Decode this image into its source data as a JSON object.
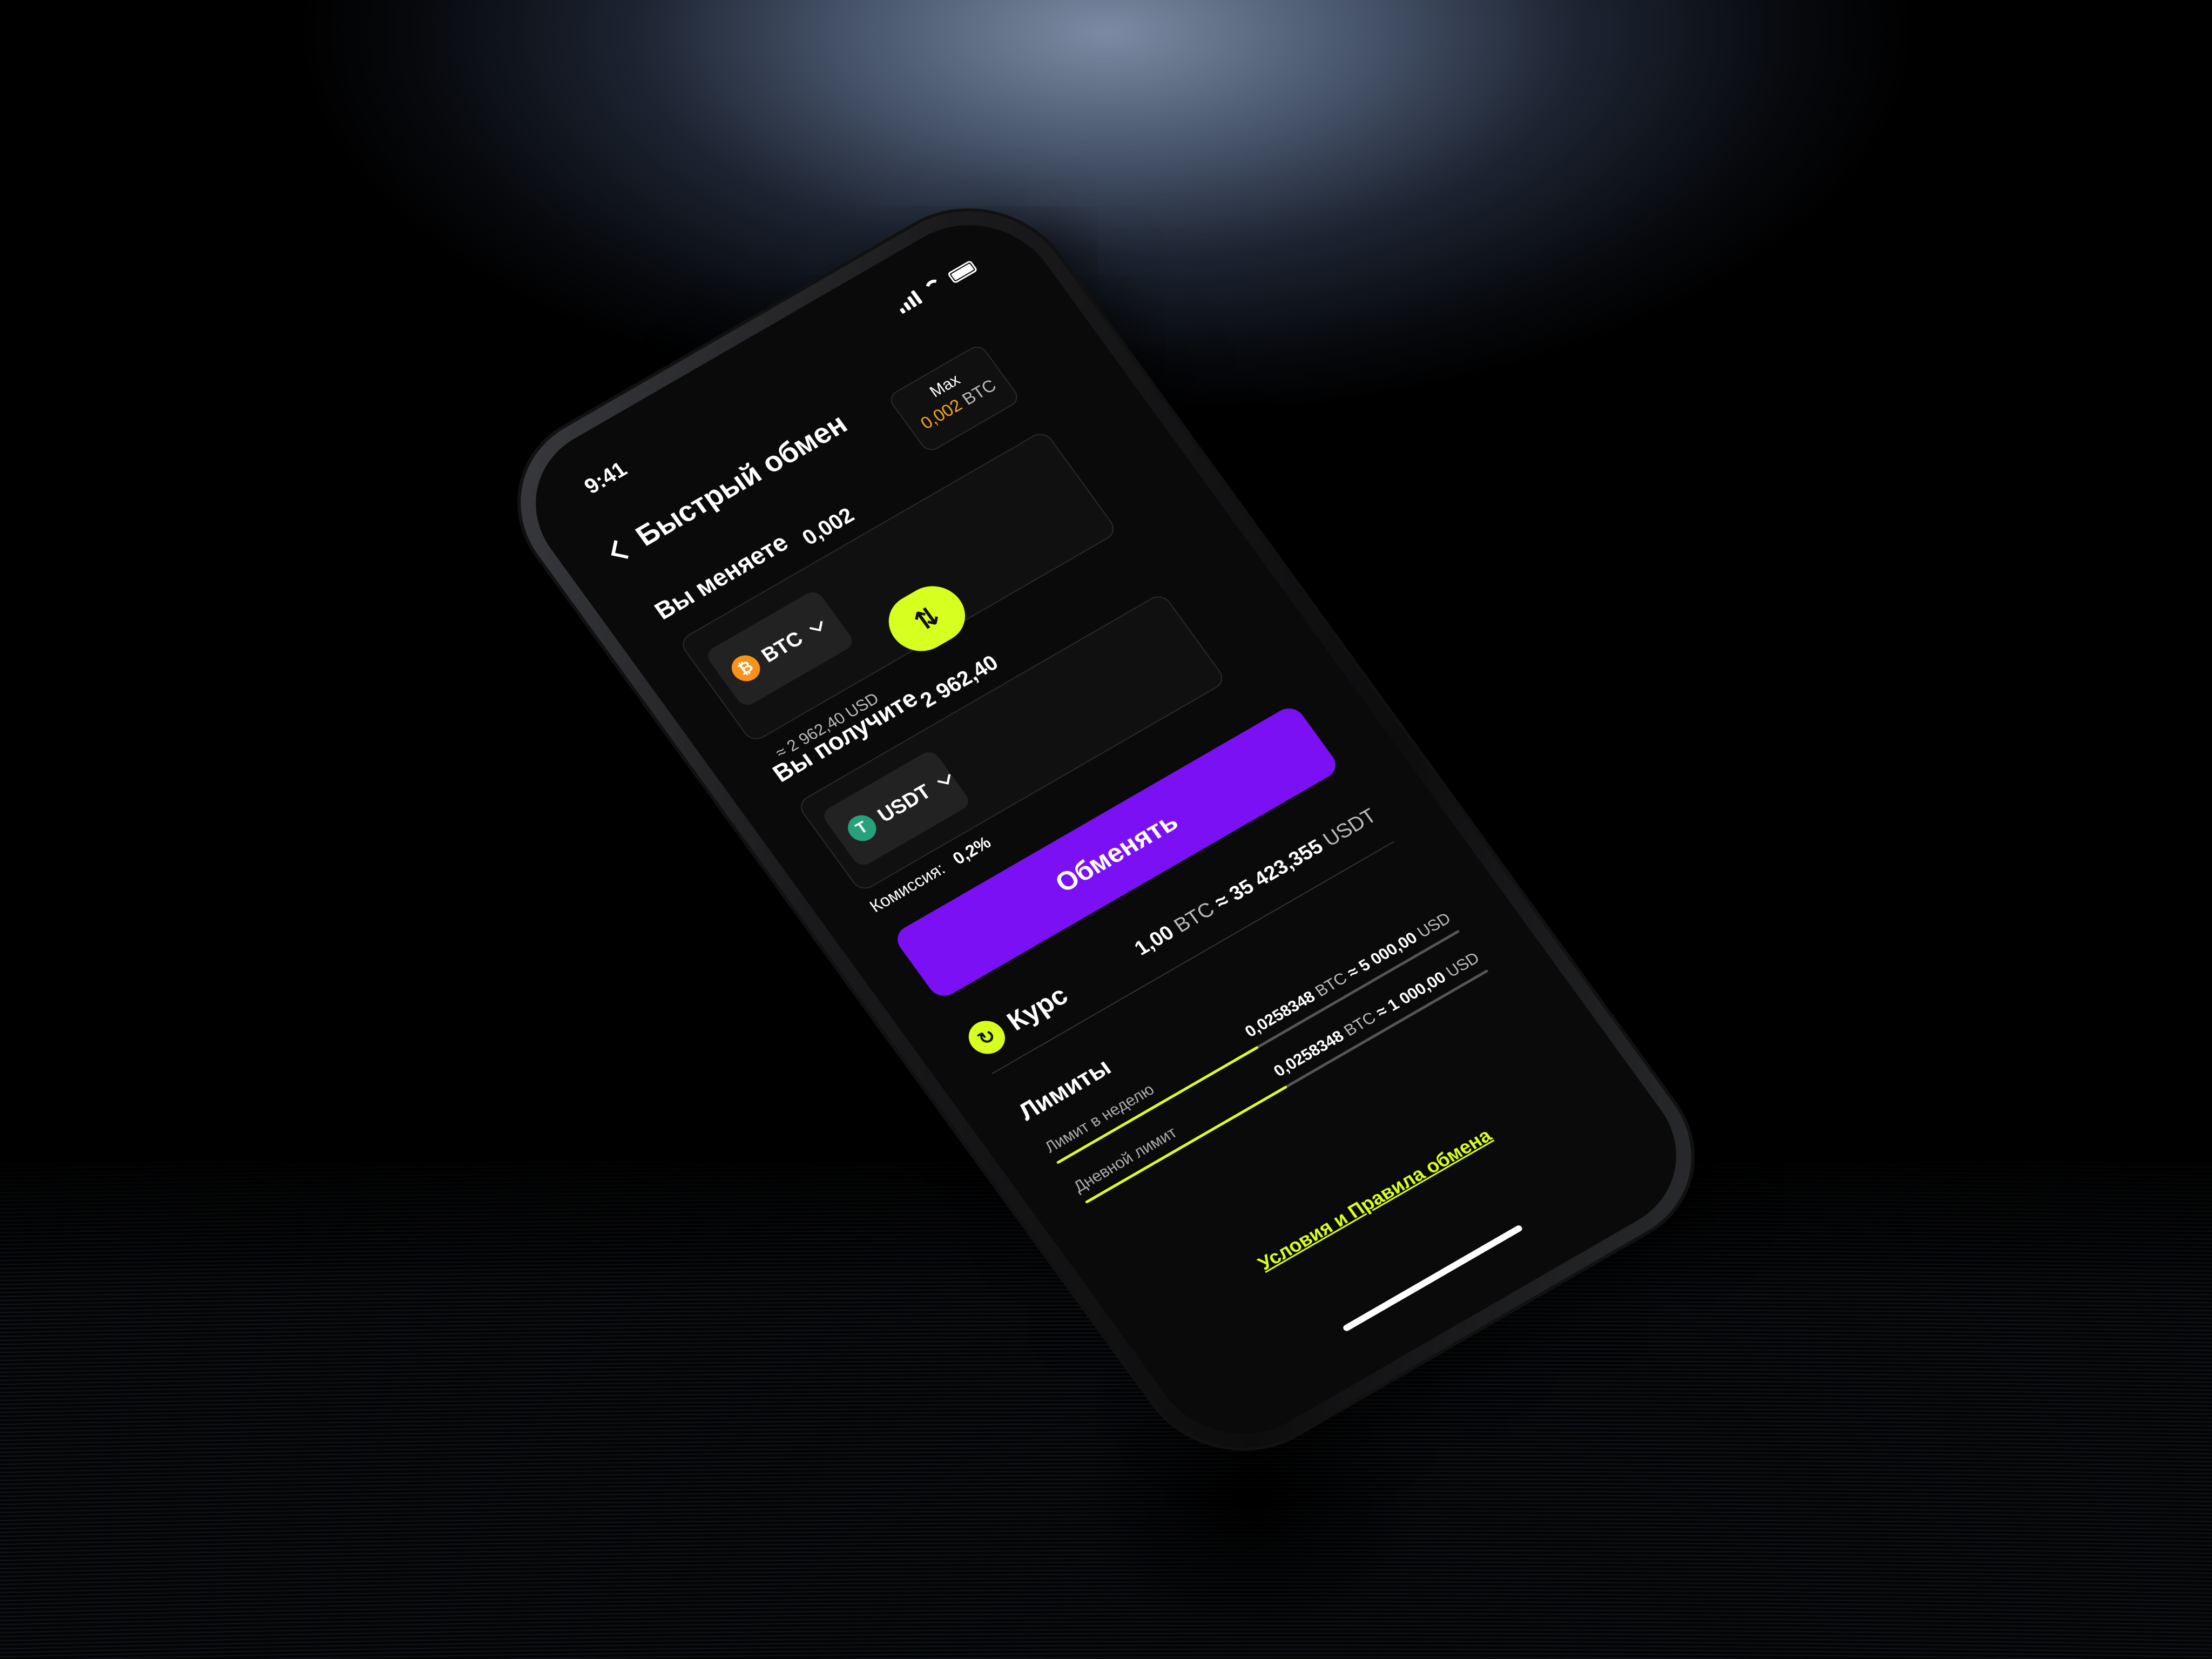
{
  "status": {
    "time": "9:41"
  },
  "header": {
    "title": "Быстрый обмен"
  },
  "send": {
    "label": "Вы меняете",
    "coin": "BTC",
    "coin_symbol": "₿",
    "coin_color": "#f7931a",
    "amount": "0,002",
    "approx_value": "≈ 2 962,40",
    "approx_unit": "USD",
    "max_label": "Max",
    "max_value": "0,002",
    "max_unit": "BTC"
  },
  "swap_icon": "⇅",
  "receive": {
    "label": "Вы получите",
    "coin": "USDT",
    "coin_symbol": "T",
    "coin_color": "#26a17b",
    "amount": "2 962,40"
  },
  "commission": {
    "label": "Комиссия:",
    "value": "0,2%"
  },
  "exchange_button": "Обменять",
  "rate": {
    "title": "Курс",
    "icon": "refresh-icon",
    "left_amount": "1,00",
    "left_unit": "BTC",
    "approx": "≈",
    "right_amount": "35 423,355",
    "right_unit": "USDT"
  },
  "limits": {
    "title": "Лимиты",
    "items": [
      {
        "label": "Лимит в неделю",
        "value_btc": "0,0258348",
        "unit_btc": "BTC",
        "approx": "≈",
        "value_usd": "5 000,00",
        "unit_usd": "USD",
        "fill": 0.5
      },
      {
        "label": "Дневной лимит",
        "value_btc": "0,0258348",
        "unit_btc": "BTC",
        "approx": "≈",
        "value_usd": "1 000,00",
        "unit_usd": "USD",
        "fill": 0.5
      }
    ]
  },
  "terms_link": "Условия и Правила обмена",
  "colors": {
    "accent": "#d7ff1f",
    "primary": "#7b10f5",
    "background": "#0a0a0a"
  }
}
